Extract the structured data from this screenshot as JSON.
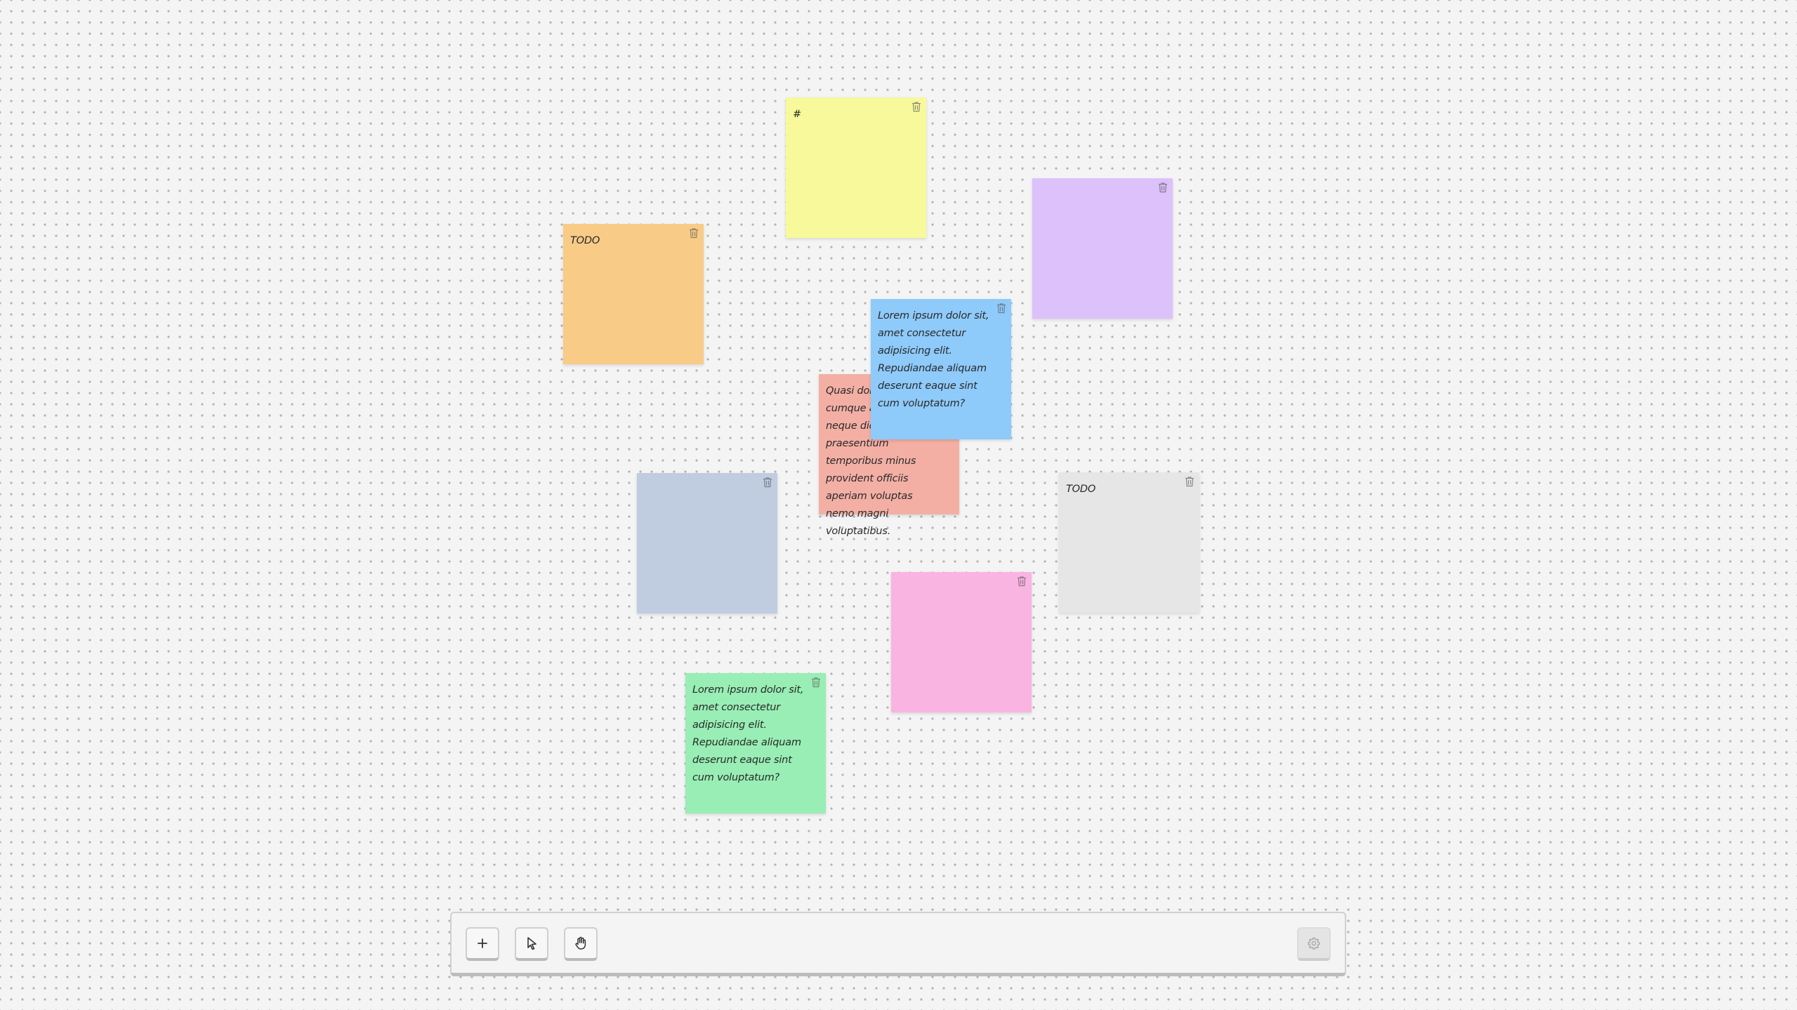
{
  "canvas": {
    "background": "#f4f4f4",
    "dot_color": "#b3b3b3"
  },
  "notes": [
    {
      "id": "yellow",
      "color": "#f7f99a",
      "text": "#",
      "delete_icon": "trash-icon"
    },
    {
      "id": "purple",
      "color": "#dcc1fb",
      "text": "",
      "delete_icon": "trash-icon"
    },
    {
      "id": "orange",
      "color": "#f8cb87",
      "text": "TODO",
      "delete_icon": "trash-icon"
    },
    {
      "id": "red",
      "color": "#f3afa4",
      "text": "Quasi dolorem voluptas cumque aliquid sit ut neque dicta praesentium temporibus minus provident officiis aperiam voluptas nemo magni voluptatibus.",
      "delete_icon": "trash-icon"
    },
    {
      "id": "blue",
      "color": "#8ecafa",
      "text": "Lorem ipsum dolor sit, amet consectetur adipisicing elit. Repudiandae aliquam deserunt eaque sint cum voluptatum?",
      "delete_icon": "trash-icon"
    },
    {
      "id": "slate",
      "color": "#c0cce0",
      "text": "",
      "delete_icon": "trash-icon"
    },
    {
      "id": "gray",
      "color": "#e6e6e6",
      "text": "TODO",
      "delete_icon": "trash-icon"
    },
    {
      "id": "pink",
      "color": "#f9b4e2",
      "text": "",
      "delete_icon": "trash-icon"
    },
    {
      "id": "green",
      "color": "#98eeb4",
      "text": "Lorem ipsum dolor sit, amet consectetur adipisicing elit. Repudiandae aliquam deserunt eaque sint cum voluptatum?",
      "delete_icon": "trash-icon"
    }
  ],
  "toolbar": {
    "add_icon": "plus-icon",
    "select_icon": "cursor-arrow-icon",
    "pan_icon": "hand-icon",
    "settings_icon": "gear-icon"
  }
}
